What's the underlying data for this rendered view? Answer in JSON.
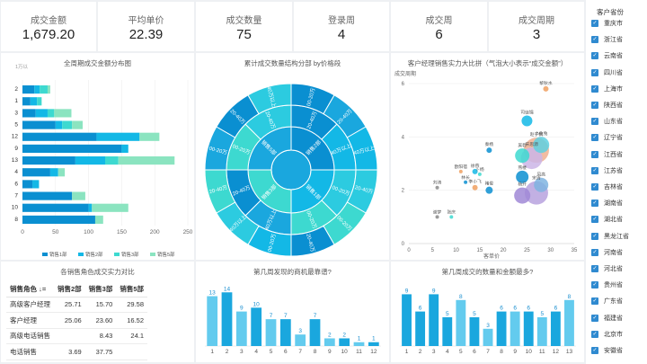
{
  "kpis": [
    {
      "title": "成交金额",
      "value": "1,679.20"
    },
    {
      "title": "平均单价",
      "value": "22.39"
    },
    {
      "title": "成交数量",
      "value": "75"
    },
    {
      "title": "登录周",
      "value": "4"
    },
    {
      "title": "成交周",
      "value": "6"
    },
    {
      "title": "成交周期",
      "value": "3"
    }
  ],
  "charts": {
    "bar_title": "全周期成交金额分布图",
    "sunburst_title": "累计成交数量结构分部 by价格段",
    "bubble_title": "客户经理销售实力大比拼（气泡大小表示“成交金额”）",
    "table_title": "各销售角色成交实力对比",
    "col1_title": "第几周发现的商机最靠谱?",
    "col2_title": "第几周成交的数量和金额最多?"
  },
  "table": {
    "headers": [
      "销售角色 ↓=",
      "销售2部",
      "销售3部",
      "销售5部"
    ],
    "rows": [
      {
        "role": "高级客户经理",
        "c1": "25.71",
        "c2": "15.70",
        "c3": "29.58"
      },
      {
        "role": "客户经理",
        "c1": "25.06",
        "c2": "23.60",
        "c3": "16.52"
      },
      {
        "role": "高级电话销售",
        "c1": "",
        "c2": "8.43",
        "c3": "24.1"
      },
      {
        "role": "电话销售",
        "c1": "3.69",
        "c2": "37.75",
        "c3": ""
      }
    ]
  },
  "filter": {
    "title": "客户省份",
    "items": [
      "重庆市",
      "浙江省",
      "云南省",
      "四川省",
      "上海市",
      "陕西省",
      "山东省",
      "辽宁省",
      "江西省",
      "江苏省",
      "吉林省",
      "湖南省",
      "湖北省",
      "黑龙江省",
      "河南省",
      "河北省",
      "贵州省",
      "广东省",
      "福建省",
      "北京市",
      "安徽省"
    ]
  },
  "chart_data": [
    {
      "type": "bar",
      "title": "全周期成交金额分布图",
      "ylabel": "",
      "xlabel": "",
      "ylim_label": "1万以",
      "categories": [
        "2",
        "1",
        "3",
        "5",
        "12",
        "9",
        "13",
        "4",
        "6",
        "7",
        "10",
        "8"
      ],
      "series": [
        {
          "name": "销售1部",
          "values": [
            18,
            12,
            20,
            50,
            112,
            150,
            80,
            42,
            15,
            75,
            100,
            110
          ],
          "color": "#0a8fd1"
        },
        {
          "name": "销售2部",
          "values": [
            8,
            10,
            18,
            10,
            65,
            10,
            45,
            12,
            10,
            0,
            5,
            0
          ],
          "color": "#13b8e6"
        },
        {
          "name": "销售3部",
          "values": [
            12,
            7,
            10,
            15,
            0,
            0,
            20,
            0,
            0,
            0,
            0,
            0
          ],
          "color": "#3dd9d0"
        },
        {
          "name": "销售5部",
          "values": [
            4,
            0,
            26,
            16,
            30,
            0,
            85,
            10,
            0,
            20,
            55,
            12
          ],
          "color": "#8be4c0"
        }
      ],
      "xticks": [
        "0",
        "50",
        "100",
        "150",
        "200",
        "250"
      ],
      "xlim": [
        0,
        250
      ],
      "legend": "bottom"
    },
    {
      "type": "pie",
      "title": "累计成交数量结构分部 by价格段",
      "inner_labels": [
        "销售2部",
        "销售1部",
        "销售3部",
        "销售5部"
      ],
      "outer_labels": [
        "00-20万",
        "20-40万",
        "40万以上",
        "20-40万",
        "00-20万",
        "20-40万",
        "00-20万",
        "40万以上",
        "20-40万",
        "00-20万",
        "20-40万",
        "40万以上"
      ],
      "center_labels": [
        "20-40万",
        "40万以上",
        "00-20万",
        "00-20万",
        "40万以上",
        "20-40万",
        "00-20万",
        "20-40万"
      ]
    },
    {
      "type": "scatter",
      "title": "客户经理销售实力大比拼（气泡大小表示“成交金额”）",
      "xlabel": "客单价",
      "ylabel": "成交周期",
      "xlim": [
        0,
        35
      ],
      "ylim": [
        0,
        6
      ],
      "xticks": [
        "0",
        "5",
        "10",
        "15",
        "20",
        "25",
        "30",
        "35"
      ],
      "yticks": [
        "0",
        "2",
        "4",
        "6"
      ],
      "points": [
        {
          "name": "黎秋水",
          "x": 29,
          "y": 5.8,
          "size": 3,
          "color": "#f0a060"
        },
        {
          "name": "司徒锦",
          "x": 25,
          "y": 4.6,
          "size": 6,
          "color": "#13b8e6"
        },
        {
          "name": "小兔兔",
          "x": 28,
          "y": 3.7,
          "size": 9,
          "color": "#5fd0e0"
        },
        {
          "name": "赵子枫",
          "x": 27,
          "y": 3.5,
          "size": 14,
          "color": "#f0b090"
        },
        {
          "name": "宋思源",
          "x": 26,
          "y": 3.2,
          "size": 12,
          "color": "#cbb5e6"
        },
        {
          "name": "吴碧",
          "x": 24,
          "y": 3.3,
          "size": 8,
          "color": "#3dd9d0"
        },
        {
          "name": "风高",
          "x": 28,
          "y": 2.2,
          "size": 8,
          "color": "#7fb4e0"
        },
        {
          "name": "燕楼",
          "x": 24,
          "y": 2.5,
          "size": 7,
          "color": "#0a8fd1"
        },
        {
          "name": "宋清",
          "x": 27,
          "y": 1.9,
          "size": 13,
          "color": "#b7a2de"
        },
        {
          "name": "杨开",
          "x": 24,
          "y": 1.8,
          "size": 9,
          "color": "#a088d6"
        },
        {
          "name": "秦杨",
          "x": 17,
          "y": 3.5,
          "size": 3,
          "color": "#0a8fd1"
        },
        {
          "name": "欧阳蓓",
          "x": 11,
          "y": 2.7,
          "size": 2,
          "color": "#f0a060"
        },
        {
          "name": "卜杨",
          "x": 15,
          "y": 2.6,
          "size": 2,
          "color": "#3dd9d0"
        },
        {
          "name": "徐燕",
          "x": 14,
          "y": 2.7,
          "size": 3,
          "color": "#13b8e6"
        },
        {
          "name": "林长",
          "x": 12,
          "y": 2.3,
          "size": 2,
          "color": "#0a8fd1"
        },
        {
          "name": "李小飞",
          "x": 14,
          "y": 2.1,
          "size": 3,
          "color": "#f0a060"
        },
        {
          "name": "刘涛",
          "x": 6,
          "y": 2.1,
          "size": 2,
          "color": "#888888"
        },
        {
          "name": "褚俊",
          "x": 17,
          "y": 2.0,
          "size": 4,
          "color": "#0a8fd1"
        },
        {
          "name": "谢梦",
          "x": 6,
          "y": 1.0,
          "size": 2,
          "color": "#888888"
        },
        {
          "name": "张庆",
          "x": 9,
          "y": 1.0,
          "size": 2,
          "color": "#3dd9d0"
        }
      ]
    },
    {
      "type": "bar",
      "title": "第几周发现的商机最靠谱?",
      "categories": [
        "1",
        "2",
        "3",
        "4",
        "5",
        "6",
        "7",
        "8",
        "9",
        "10",
        "11",
        "12"
      ],
      "values": [
        13,
        14,
        9,
        10,
        7,
        7,
        3,
        7,
        2,
        2,
        1,
        1
      ],
      "ylim": [
        0,
        15
      ]
    },
    {
      "type": "bar",
      "title": "第几周成交的数量和金额最多?",
      "categories": [
        "1",
        "2",
        "3",
        "4",
        "5",
        "6",
        "7",
        "8",
        "9",
        "10",
        "11",
        "12",
        "13"
      ],
      "values": [
        9,
        6,
        9,
        5,
        8,
        5,
        3,
        6,
        6,
        6,
        5,
        6,
        8
      ],
      "ylim": [
        0,
        10
      ]
    }
  ],
  "colors": {
    "c1": "#0a8fd1",
    "c2": "#13b8e6",
    "c3": "#3dd9d0",
    "c4": "#8be4c0",
    "check": "#2f8ad0"
  }
}
